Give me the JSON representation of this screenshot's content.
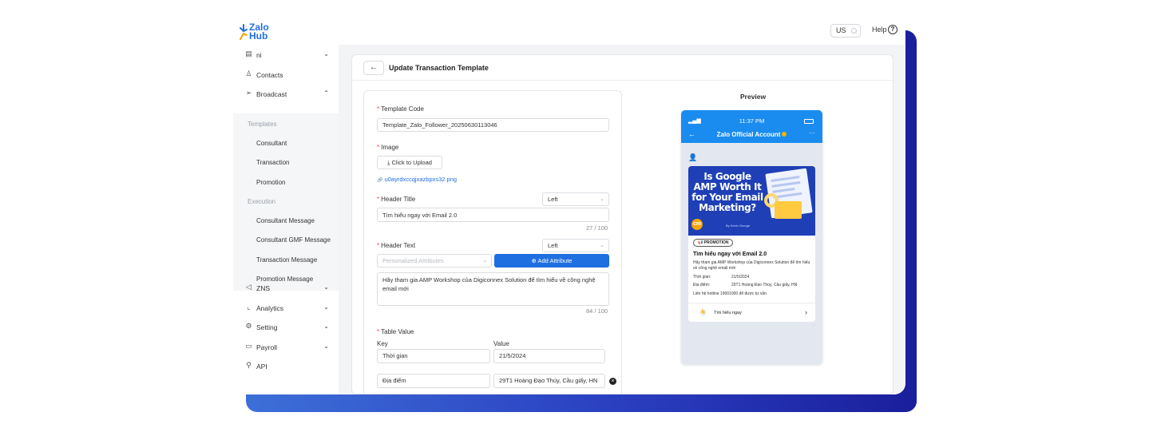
{
  "app": {
    "logo_line1": "Zalo",
    "logo_line2": "Hub",
    "brand_color": "#1f6fe0"
  },
  "topbar": {
    "language": "US",
    "help": "Help",
    "help_icon": "?"
  },
  "sidebar": {
    "items": [
      {
        "label": "ni",
        "icon": "list-icon",
        "glyph": "▤",
        "chevron": "⌄"
      },
      {
        "label": "Contacts",
        "icon": "user-icon",
        "glyph": "♙",
        "chevron": ""
      },
      {
        "label": "Broadcast",
        "icon": "send-icon",
        "glyph": "➢",
        "chevron": "⌃"
      },
      {
        "label": "ZNS",
        "icon": "megaphone-icon",
        "glyph": "◁",
        "chevron": "⌄"
      },
      {
        "label": "Analytics",
        "icon": "chart-icon",
        "glyph": "⌞",
        "chevron": "⌄"
      },
      {
        "label": "Setting",
        "icon": "gear-icon",
        "glyph": "⚙",
        "chevron": "⌄"
      },
      {
        "label": "Payroll",
        "icon": "card-icon",
        "glyph": "▭",
        "chevron": "⌄"
      },
      {
        "label": "API",
        "icon": "link-icon",
        "glyph": "⚲",
        "chevron": ""
      }
    ],
    "broadcast_sub": {
      "templates_heading": "Templates",
      "templates": [
        "Consultant",
        "Transaction",
        "Promotion"
      ],
      "execution_heading": "Execution",
      "execution": [
        "Consultant Message",
        "Consultant GMF Message",
        "Transaction Message",
        "Promotion Message"
      ]
    }
  },
  "page": {
    "back_icon": "←",
    "title": "Update Transaction Template",
    "form": {
      "template_code_label": "Template Code",
      "template_code_value": "Template_Zalo_Follower_20250630113046",
      "image_label": "Image",
      "upload_label": "Click to Upload",
      "upload_icon": "⤓",
      "file_icon": "🔗",
      "file_name": "u0ayrdxccqjxazbpxs32.png",
      "header_title_label": "Header Title",
      "header_title_align": "Left",
      "header_title_value": "Tìm hiểu ngay với Email 2.0",
      "header_title_count": "27 / 100",
      "header_text_label": "Header Text",
      "header_text_align": "Left",
      "attributes_placeholder": "Personalized Attributes",
      "add_attribute_label": "Add Attribute",
      "add_attribute_icon": "⊕",
      "header_text_value": "Hãy tham gia AMP Workshop của Digiconnex Solution để tìm hiểu về công nghệ email mới",
      "header_text_count": "84 / 100",
      "table_value_label": "Table Value",
      "key_label": "Key",
      "value_label": "Value",
      "rows": [
        {
          "key": "Thời gian",
          "value": "21/5/2024"
        },
        {
          "key": "Địa điểm",
          "value": "29T1 Hoàng Đạo Thúy, Cầu giấy, HN"
        }
      ],
      "remove_icon": "×",
      "dropdown_icon": "⌄",
      "required_mark": "*"
    }
  },
  "preview": {
    "title": "Preview",
    "time": "11:37 PM",
    "signal": "▂▄▆",
    "back_icon": "←",
    "oa_name": "Zalo Official Account",
    "more_icon": "···",
    "user_icon": "👤",
    "banner_text": "Is Google AMP Worth It for Your Email Marketing?",
    "banner_logo": "cm",
    "banner_author": "By Kevin George",
    "promo_icon": "📢",
    "badge": "PROMOTION",
    "msg_title": "Tìm hiểu ngay với Email 2.0",
    "msg_body": "Hãy tham gia AMP Workshop của Digiconnex Solution để tìm hiểu về công nghệ email mới",
    "rows": [
      {
        "key": "Thời gian:",
        "value": "21/5/2024"
      },
      {
        "key": "Địa điểm:",
        "value": "29T1 Hoàng Đạo Thúy, Cầu giấy, HN"
      }
    ],
    "hotline": "Liên hệ hotline 19001000 để được tư vấn",
    "cta_icon": "👆",
    "cta_label": "Tìm hiểu ngay",
    "cta_chevron": "›"
  }
}
